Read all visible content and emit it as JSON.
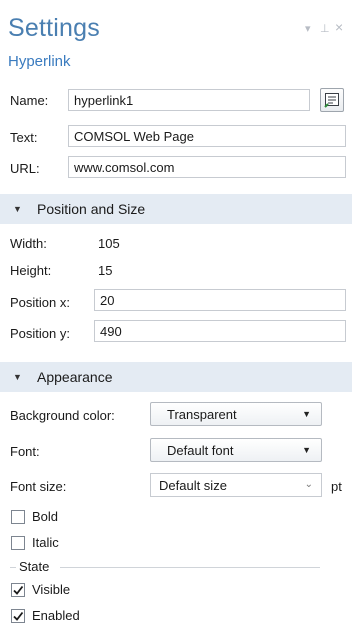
{
  "header": {
    "title": "Settings",
    "subtitle": "Hyperlink",
    "controls": {
      "dropdown": "▾",
      "pin": "⊥",
      "close": "×"
    }
  },
  "general": {
    "name_label": "Name:",
    "name_value": "hyperlink1",
    "text_label": "Text:",
    "text_value": "COMSOL Web Page",
    "url_label": "URL:",
    "url_value": "www.comsol.com"
  },
  "position_section": {
    "title": "Position and Size",
    "width_label": "Width:",
    "width_value": "105",
    "height_label": "Height:",
    "height_value": "15",
    "pos_x_label": "Position x:",
    "pos_x_value": "20",
    "pos_y_label": "Position y:",
    "pos_y_value": "490"
  },
  "appearance_section": {
    "title": "Appearance",
    "bg_color_label": "Background color:",
    "bg_color_value": "Transparent",
    "font_label": "Font:",
    "font_value": "Default font",
    "font_size_label": "Font size:",
    "font_size_value": "Default size",
    "font_size_unit": "pt",
    "bold_label": "Bold",
    "bold_checked": false,
    "italic_label": "Italic",
    "italic_checked": false,
    "state_label": "State",
    "visible_label": "Visible",
    "visible_checked": true,
    "enabled_label": "Enabled",
    "enabled_checked": true
  },
  "icons": {
    "edit_name": "rename-icon",
    "section_caret": "caret-down-icon",
    "check": "checkmark-icon"
  },
  "colors": {
    "title": "#4a7fb1",
    "subtitle": "#3a7bbf",
    "section_bg": "#e4ebf3"
  }
}
